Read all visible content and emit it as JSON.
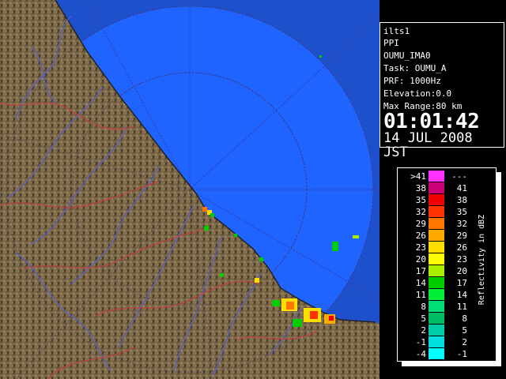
{
  "info": {
    "site": "ilts1",
    "product": "PPI",
    "station": "OUMU_IMA0",
    "task": "Task: OUMU_A",
    "prf": "PRF: 1000Hz",
    "elevation": "Elevation:0.0",
    "max_range": "Max Range:80 km",
    "time": "01:01:42",
    "date": "14 JUL 2008 JST"
  },
  "legend": {
    "unit_label": "Reflectivity in dBZ",
    "bins": [
      {
        "low": ">41",
        "high": "---",
        "color": "#ff33ff"
      },
      {
        "low": "38",
        "high": "41",
        "color": "#cc0077"
      },
      {
        "low": "35",
        "high": "38",
        "color": "#ee0000"
      },
      {
        "low": "32",
        "high": "35",
        "color": "#ff3300"
      },
      {
        "low": "29",
        "high": "32",
        "color": "#ff7700"
      },
      {
        "low": "26",
        "high": "29",
        "color": "#ffaa00"
      },
      {
        "low": "23",
        "high": "26",
        "color": "#ffdd00"
      },
      {
        "low": "20",
        "high": "23",
        "color": "#ffff00"
      },
      {
        "low": "17",
        "high": "20",
        "color": "#aaee00"
      },
      {
        "low": "14",
        "high": "17",
        "color": "#00cc00"
      },
      {
        "low": "11",
        "high": "14",
        "color": "#00ee33"
      },
      {
        "low": "8",
        "high": "11",
        "color": "#00dd77"
      },
      {
        "low": "5",
        "high": "8",
        "color": "#00bb66"
      },
      {
        "low": "2",
        "high": "5",
        "color": "#00ccaa"
      },
      {
        "low": "-1",
        "high": "2",
        "color": "#00dddd"
      },
      {
        "low": "-4",
        "high": "-1",
        "color": "#00ffff"
      }
    ]
  },
  "colors": {
    "sea_inner": "#1f64ff",
    "sea_outer": "#1e50cc",
    "land": "#7a6748",
    "rivers": "#5560d0",
    "borders": "#c04040"
  }
}
